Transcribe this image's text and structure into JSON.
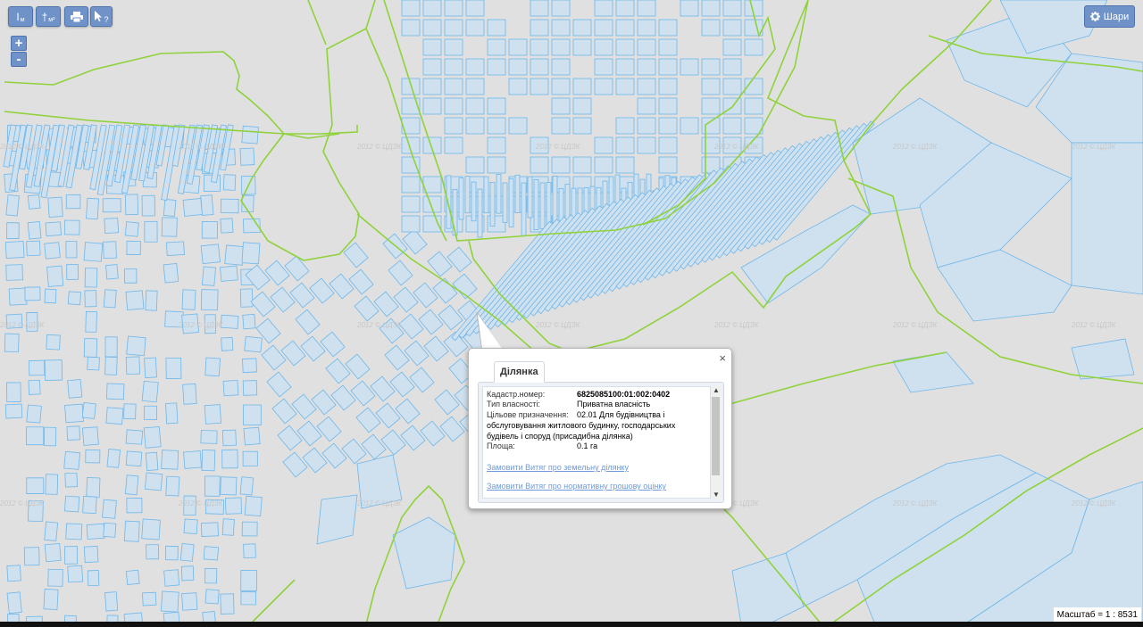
{
  "toolbar": {
    "measure_length_label": "I",
    "measure_length_unit": "м",
    "measure_area_label": "†",
    "measure_area_unit": "м²",
    "print_icon": "printer-icon",
    "identify_icon": "cursor-question-icon",
    "identify_label": "?",
    "zoom_in_label": "+",
    "zoom_out_label": "-"
  },
  "layers_button": {
    "label": "Шари",
    "icon": "gear-icon"
  },
  "watermark": "2012 © ЦДЗК",
  "popup": {
    "tab_title": "Ділянка",
    "close_label": "×",
    "fields": {
      "cadastre_label": "Кадастр.номер:",
      "cadastre_value": "6825085100:01:002:0402",
      "ownership_label": "Тип власності:",
      "ownership_value": "Приватна власність",
      "purpose_label": "Цільове призначення:",
      "purpose_value_1": "02.01 Для будівництва і",
      "purpose_value_2": "обслуговування житлового будинку, господарських",
      "purpose_value_3": "будівель і споруд (присадибна ділянка)",
      "area_label": "Площа:",
      "area_value": "0.1 га"
    },
    "links": {
      "extract_land": "Замовити Витяг про земельну ділянку",
      "extract_valuation": "Замовити Витяг про нормативну грошову оцінку"
    }
  },
  "scale": {
    "label": "Масштаб = 1 : 8531"
  },
  "colors": {
    "background": "#e0e0e0",
    "parcel_fill": "#cfe0ee",
    "parcel_stroke": "#6fb7ea",
    "boundary": "#8fd23a",
    "button": "#6f93c9"
  }
}
